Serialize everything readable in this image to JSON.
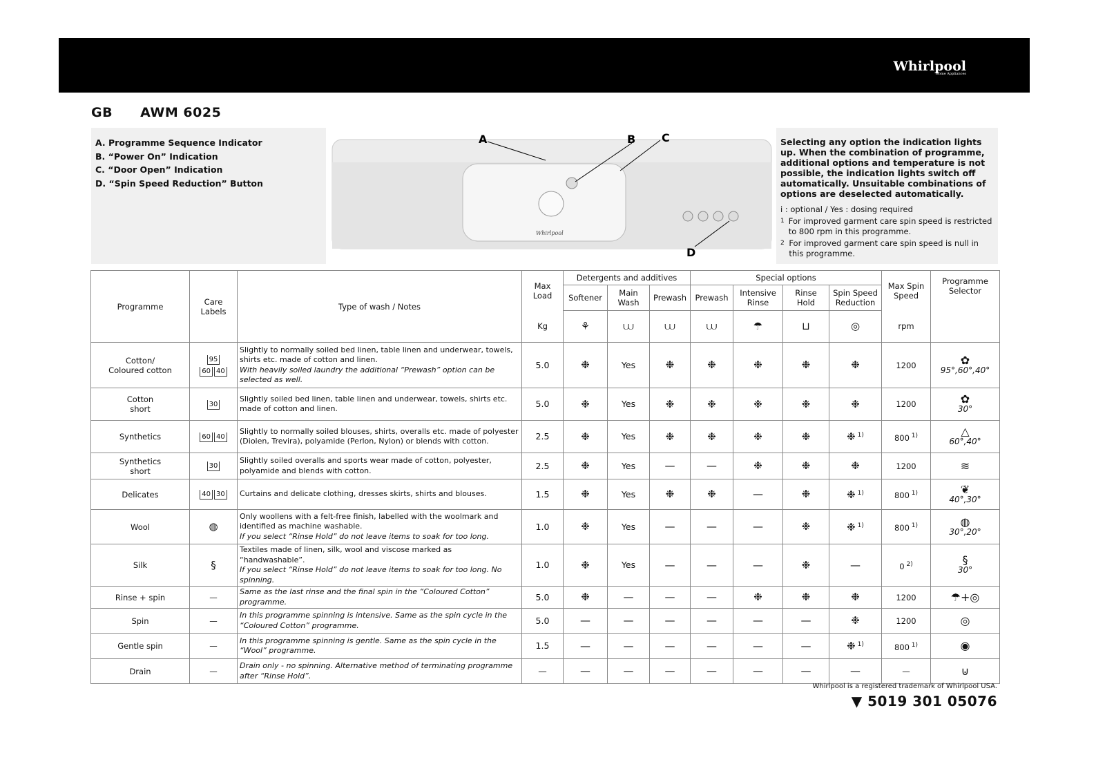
{
  "header": {
    "brand": "Whirlpool",
    "brand_sub": "Home Appliances"
  },
  "model": {
    "country": "GB",
    "name": "AWM 6025"
  },
  "legend": [
    "A. Programme Sequence Indicator",
    "B. “Power On” Indication",
    "C. “Door Open” Indication",
    "D. “Spin Speed Reduction” Button"
  ],
  "panel": {
    "labels": [
      "A",
      "B",
      "C",
      "D"
    ],
    "brand": "Whirlpool"
  },
  "info": {
    "bold": "Selecting any option the indication lights up. When the combination of programme, additional options and temperature is not possible, the indication lights switch off automatically. Unsuitable combinations of options are deselected automatically.",
    "key": "i : optional / Yes : dosing required",
    "notes": [
      {
        "num": "1",
        "text": "For improved garment care spin speed is restricted to 800 rpm in this programme."
      },
      {
        "num": "2",
        "text": "For improved garment care spin speed is null in this programme."
      }
    ]
  },
  "table": {
    "headers": {
      "programme": "Programme",
      "care": "Care Labels",
      "type": "Type of wash / Notes",
      "maxload": "Max Load",
      "kg": "Kg",
      "detergents": "Detergents and additives",
      "special": "Special options",
      "softener": "Softener",
      "mainwash": "Main Wash",
      "prewash": "Prewash",
      "prewash2": "Prewash",
      "intensive": "Intensive Rinse",
      "rinsehold": "Rinse Hold",
      "spinred": "Spin Speed Reduction",
      "maxspin": "Max Spin Speed",
      "rpm": "rpm",
      "selector": "Programme Selector"
    },
    "header_icons": [
      "softener-icon",
      "main-wash-icon",
      "prewash-icon",
      "prewash-icon",
      "intensive-rinse-icon",
      "rinse-hold-icon",
      "spin-icon"
    ],
    "rows": [
      {
        "programme": "Cotton/\nColoured cotton",
        "care": [
          "95",
          "60",
          "40"
        ],
        "notes": "Slightly to normally soiled bed linen, table linen and underwear, towels, shirts etc. made of cotton and linen.",
        "notes_italic": "With heavily soiled laundry the additional “Prewash” option can be selected as well.",
        "load": "5.0",
        "opts": [
          "❉",
          "Yes",
          "❉",
          "❉",
          "❉",
          "❉",
          "❉"
        ],
        "spin": "1200",
        "selector_icon": "cotton-icon",
        "selector": "95°,60°,40°"
      },
      {
        "programme": "Cotton\nshort",
        "care": [
          "30"
        ],
        "notes": "Slightly soiled bed linen, table linen and underwear, towels, shirts etc. made of cotton and linen.",
        "load": "5.0",
        "opts": [
          "❉",
          "Yes",
          "❉",
          "❉",
          "❉",
          "❉",
          "❉"
        ],
        "spin": "1200",
        "selector_icon": "cotton-icon",
        "selector": "30°"
      },
      {
        "programme": "Synthetics",
        "care": [
          "60",
          "40"
        ],
        "notes": "Slightly to normally soiled blouses, shirts, overalls etc. made of polyester (Diolen, Trevira), polyamide (Perlon, Nylon) or blends with cotton.",
        "load": "2.5",
        "opts": [
          "❉",
          "Yes",
          "❉",
          "❉",
          "❉",
          "❉",
          "❉ 1)"
        ],
        "spin": "800 1)",
        "selector_icon": "synthetics-icon",
        "selector": "60°,40°"
      },
      {
        "programme": "Synthetics\nshort",
        "care": [
          "30"
        ],
        "notes": "Slightly soiled overalls and sports wear made of cotton, polyester, polyamide and blends with cotton.",
        "load": "2.5",
        "opts": [
          "❉",
          "Yes",
          "—",
          "—",
          "❉",
          "❉",
          "❉"
        ],
        "spin": "1200",
        "selector_icon": "synthetics-short-icon",
        "selector": ""
      },
      {
        "programme": "Delicates",
        "care": [
          "40",
          "30"
        ],
        "notes": "Curtains and delicate clothing, dresses skirts, shirts and blouses.",
        "load": "1.5",
        "opts": [
          "❉",
          "Yes",
          "❉",
          "❉",
          "—",
          "❉",
          "❉ 1)"
        ],
        "spin": "800 1)",
        "selector_icon": "delicates-icon",
        "selector": "40°,30°"
      },
      {
        "programme": "Wool",
        "care_icon": "wool-icon",
        "notes": "Only woollens with a felt-free finish, labelled with the woolmark and identified as machine washable.",
        "notes_italic": "If you select “Rinse Hold” do not leave items to soak for too long.",
        "load": "1.0",
        "opts": [
          "❉",
          "Yes",
          "—",
          "—",
          "—",
          "❉",
          "❉ 1)"
        ],
        "spin": "800 1)",
        "selector_icon": "wool-icon",
        "selector": "30°,20°"
      },
      {
        "programme": "Silk",
        "care_icon": "silk-icon",
        "notes": "Textiles made of linen, silk, wool and viscose marked as “handwashable”.",
        "notes_italic": "If you select “Rinse Hold” do not leave items to soak for too long. No spinning.",
        "load": "1.0",
        "opts": [
          "❉",
          "Yes",
          "—",
          "—",
          "—",
          "❉",
          "—"
        ],
        "spin": "0 2)",
        "selector_icon": "silk-icon",
        "selector": "30°"
      },
      {
        "programme": "Rinse + spin",
        "care_text": "—",
        "notes_italic": "Same as the last rinse and the final spin in the “Coloured Cotton” programme.",
        "load": "5.0",
        "opts": [
          "❉",
          "—",
          "—",
          "—",
          "❉",
          "❉",
          "❉"
        ],
        "spin": "1200",
        "selector_icon": "rinse-spin-icon",
        "selector": ""
      },
      {
        "programme": "Spin",
        "care_text": "—",
        "notes_italic": "In this programme spinning is intensive. Same as the spin cycle in the “Coloured Cotton” programme.",
        "load": "5.0",
        "opts": [
          "—",
          "—",
          "—",
          "—",
          "—",
          "—",
          "❉"
        ],
        "spin": "1200",
        "selector_icon": "spin-icon",
        "selector": ""
      },
      {
        "programme": "Gentle spin",
        "care_text": "—",
        "notes_italic": "In this programme spinning is gentle. Same as the spin cycle in the “Wool” programme.",
        "load": "1.5",
        "opts": [
          "—",
          "—",
          "—",
          "—",
          "—",
          "—",
          "❉ 1)"
        ],
        "spin": "800 1)",
        "selector_icon": "gentle-spin-icon",
        "selector": ""
      },
      {
        "programme": "Drain",
        "care_text": "—",
        "notes_italic": "Drain only - no spinning. Alternative method of terminating programme after “Rinse Hold”.",
        "load": "—",
        "opts": [
          "—",
          "—",
          "—",
          "—",
          "—",
          "—",
          "—"
        ],
        "spin": "—",
        "selector_icon": "drain-icon",
        "selector": ""
      }
    ]
  },
  "footer": {
    "trademark": "Whirlpool is a registered trademark of Whirlpool USA.",
    "code": "5019 301 05076"
  }
}
